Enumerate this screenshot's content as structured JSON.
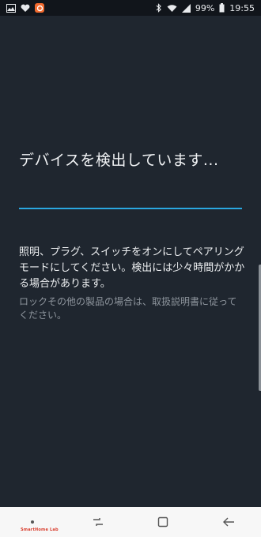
{
  "status_bar": {
    "battery": "99%",
    "time": "19:55",
    "icons": [
      "gallery-icon",
      "heart-icon",
      "app-badge-icon",
      "bluetooth-icon",
      "wifi-icon",
      "signal-icon",
      "battery-icon"
    ]
  },
  "main": {
    "title": "デバイスを検出しています...",
    "progress_fraction": 1.0,
    "description": "照明、プラグ、スイッチをオンにしてペアリングモードにしてください。検出には少々時間がかかる場合があります。",
    "note": "ロックその他の製品の場合は、取扱説明書に従ってください。"
  },
  "nav_bar": {
    "buttons": [
      "home-dot",
      "recents",
      "overview",
      "back"
    ]
  },
  "watermark": "SmartHome Lab",
  "colors": {
    "background": "#1f262f",
    "accent": "#2aa7e0",
    "statusbar": "#11151b",
    "navbar": "#f7f7f7"
  }
}
